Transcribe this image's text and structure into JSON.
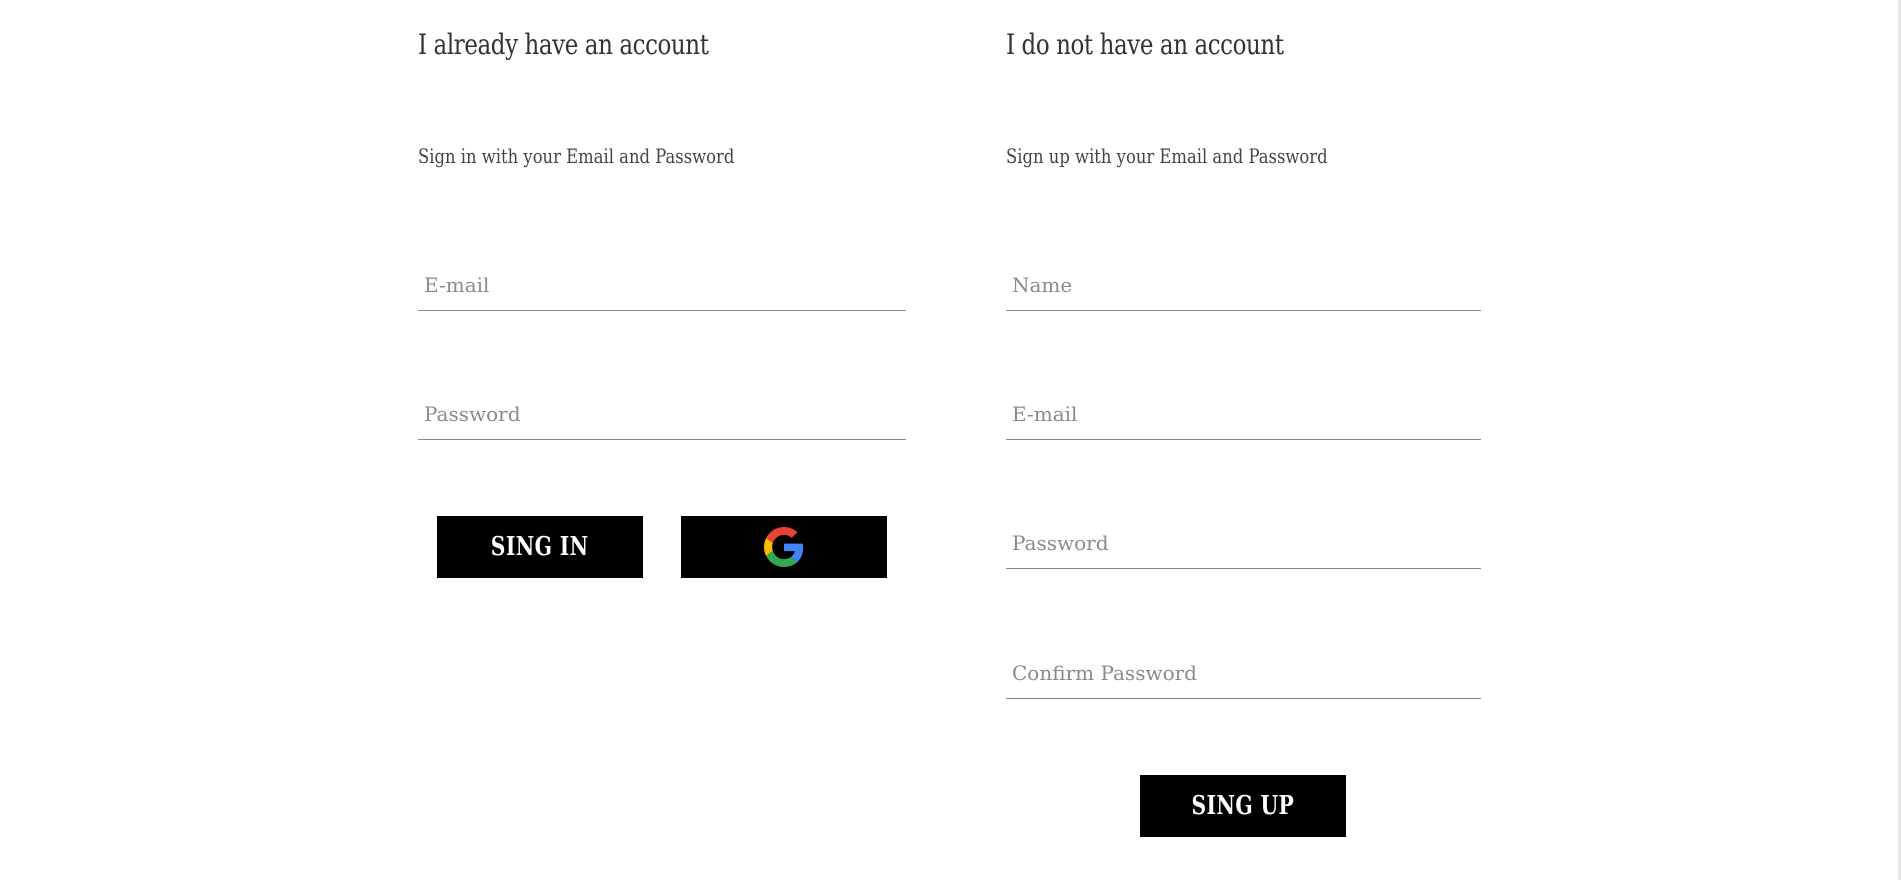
{
  "signin": {
    "heading": "I already have an account",
    "subtitle": "Sign in with your Email and Password",
    "email_placeholder": "E-mail",
    "password_placeholder": "Password",
    "submit_label": "SING IN",
    "google_icon": "google-logo"
  },
  "signup": {
    "heading": "I do not have an account",
    "subtitle": "Sign up with your Email and Password",
    "name_placeholder": "Name",
    "email_placeholder": "E-mail",
    "password_placeholder": "Password",
    "confirm_placeholder": "Confirm Password",
    "submit_label": "SING UP"
  },
  "colors": {
    "button_bg": "#000000",
    "button_text": "#ffffff",
    "heading_text": "#333333",
    "placeholder_text": "#8a8a8a",
    "underline": "#8a8a8a",
    "google_blue": "#4285F4",
    "google_red": "#EA4335",
    "google_yellow": "#FBBC05",
    "google_green": "#34A853"
  }
}
